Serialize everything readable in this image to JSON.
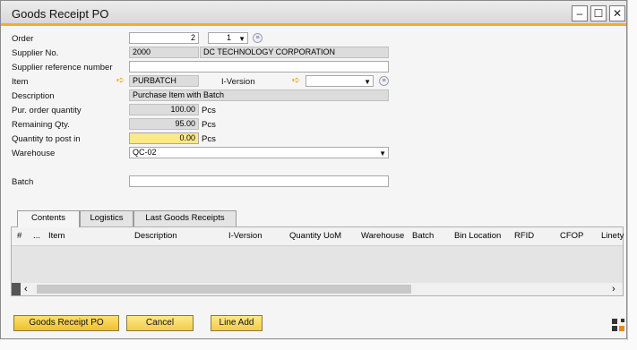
{
  "window": {
    "title": "Goods Receipt PO"
  },
  "form": {
    "order_label": "Order",
    "order_value": "2",
    "order_line": "1",
    "supplier_no_label": "Supplier No.",
    "supplier_no_value": "2000",
    "supplier_name": "DC TECHNOLOGY CORPORATION",
    "supplier_ref_label": "Supplier reference number",
    "supplier_ref_value": "",
    "item_label": "Item",
    "item_value": "PURBATCH",
    "iversion_label": "I-Version",
    "iversion_value": "",
    "description_label": "Description",
    "description_value": "Purchase Item with Batch",
    "pur_qty_label": "Pur. order quantity",
    "pur_qty_value": "100.00",
    "remaining_label": "Remaining Qty.",
    "remaining_value": "95.00",
    "post_qty_label": "Quantity to post in",
    "post_qty_value": "0.00",
    "unit": "Pcs",
    "warehouse_label": "Warehouse",
    "warehouse_value": "QC-02",
    "batch_label": "Batch",
    "batch_value": ""
  },
  "tabs": [
    {
      "label": "Contents"
    },
    {
      "label": "Logistics"
    },
    {
      "label": "Last Goods Receipts"
    }
  ],
  "grid": {
    "columns": [
      "#",
      "...",
      "Item",
      "Description",
      "I-Version",
      "Quantity UoM",
      "Warehouse",
      "Batch",
      "Bin Location",
      "RFID",
      "CFOP",
      "Linety"
    ]
  },
  "buttons": {
    "goods_receipt": "Goods Receipt PO",
    "cancel": "Cancel",
    "line_add": "Line Add"
  },
  "colors": {
    "accent": "#f0b020",
    "required": "#fde98a"
  }
}
